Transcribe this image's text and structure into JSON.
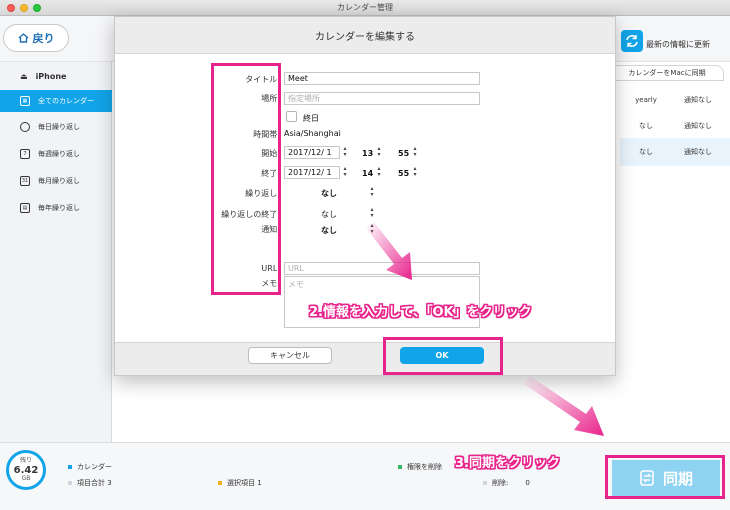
{
  "window": {
    "title": "カレンダー管理"
  },
  "toolbar": {
    "back_label": "戻り",
    "refresh_label": "最新の情報に更新"
  },
  "sidebar": {
    "device": "iPhone",
    "items": [
      {
        "label": "全てのカレンダー",
        "icon": "calendar-icon"
      },
      {
        "label": "毎日繰り返し",
        "icon": "clock-icon"
      },
      {
        "label": "毎週繰り返し",
        "icon": "calendar-7-icon"
      },
      {
        "label": "毎月繰り返し",
        "icon": "calendar-31-icon"
      },
      {
        "label": "毎年繰り返し",
        "icon": "calendar-year-icon"
      }
    ]
  },
  "table": {
    "sync_tab": "カレンダーをMacに同期",
    "rows": [
      {
        "repeat": "yearly",
        "notify": "通知なし"
      },
      {
        "repeat": "なし",
        "notify": "通知なし"
      },
      {
        "repeat": "なし",
        "notify": "通知なし"
      }
    ]
  },
  "modal": {
    "title": "カレンダーを編集する",
    "labels": {
      "title": "タイトル:",
      "location": "場所:",
      "allday": "終日",
      "timezone": "時間帯:",
      "start": "開始:",
      "end": "終了:",
      "repeat": "繰り返し:",
      "repeat_end": "繰り返しの終了:",
      "notify": "通知:",
      "url": "URL:",
      "memo": "メモ:"
    },
    "values": {
      "title": "Meet",
      "location_placeholder": "指定場所",
      "timezone": "Asia/Shanghai",
      "start_date": "2017/12/ 1",
      "start_hour": "13",
      "start_min": "55",
      "end_date": "2017/12/ 1",
      "end_hour": "14",
      "end_min": "55",
      "repeat": "なし",
      "repeat_end": "なし",
      "notify": "なし",
      "url_placeholder": "URL",
      "memo_placeholder": "メモ"
    },
    "cancel_label": "キャンセル",
    "ok_label": "OK"
  },
  "status": {
    "storage_top": "残り",
    "storage_value": "6.42",
    "storage_unit": "GB",
    "calendar": "カレンダー",
    "total": "項目合計 3",
    "selected": "選択項目 1",
    "delete_perm": "権限を削除",
    "deleted": "削除:",
    "deleted_count": "0"
  },
  "annotations": {
    "step2": "2.情報を入力して、「OK」をクリック",
    "step3": "3.同期をクリック"
  },
  "sync_label": "同期",
  "colors": {
    "accent": "#12a4e8",
    "highlight": "#e8238b"
  }
}
